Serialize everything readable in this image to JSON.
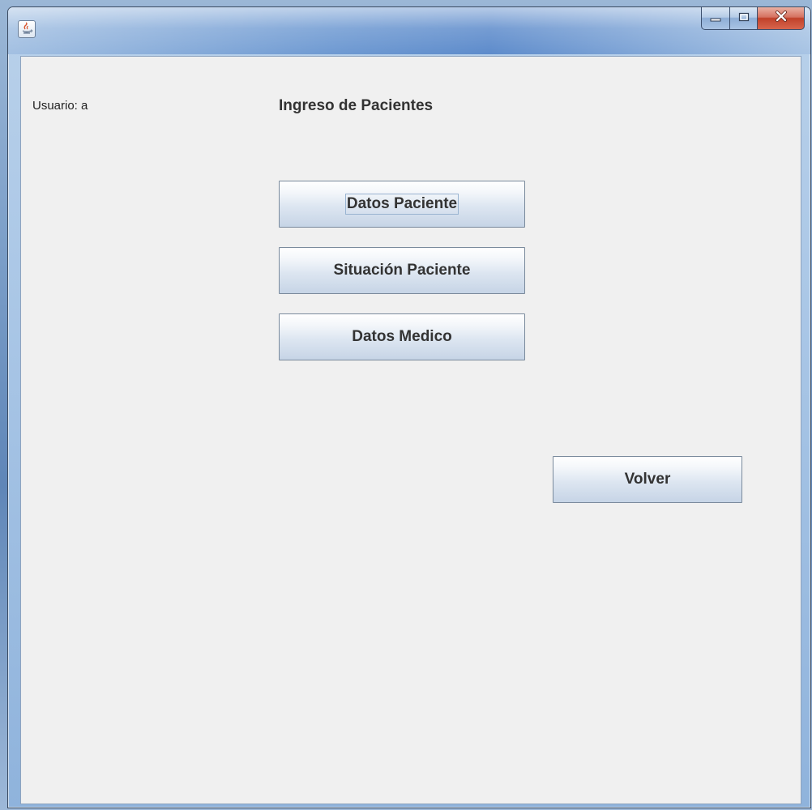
{
  "window": {
    "title": "",
    "controls": {
      "minimize_icon": "minimize-icon",
      "maximize_icon": "maximize-icon",
      "close_icon": "close-icon"
    },
    "app_icon": "java-coffee-icon"
  },
  "header": {
    "user_label": "Usuario: a",
    "title": "Ingreso de Pacientes"
  },
  "buttons": {
    "datos_paciente": "Datos Paciente",
    "situacion_paciente": "Situación Paciente",
    "datos_medico": "Datos Medico",
    "volver": "Volver"
  },
  "colors": {
    "client_background": "#f0f0f0",
    "close_button": "#c0412a",
    "text": "#333333"
  }
}
